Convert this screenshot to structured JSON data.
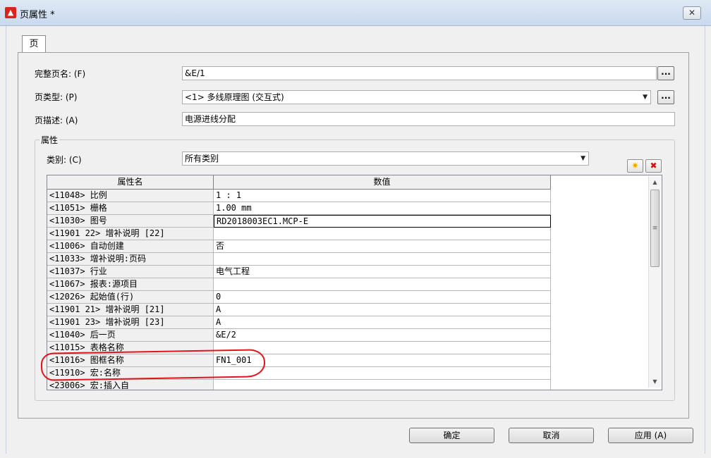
{
  "window": {
    "title": "页属性 *",
    "app_icon": "eplan-app-icon",
    "close_label": "✕"
  },
  "tab": {
    "label": "页"
  },
  "form": {
    "full_name_label": "完整页名: (F)",
    "full_name_value": "&E/1",
    "page_type_label": "页类型: (P)",
    "page_type_value": "<1> 多线原理图 (交互式)",
    "page_desc_label": "页描述: (A)",
    "page_desc_value": "电源进线分配",
    "dots_label": "..."
  },
  "properties": {
    "group_title": "属性",
    "category_label": "类别: (C)",
    "category_value": "所有类别",
    "new_icon": "new-star-icon",
    "delete_icon": "delete-x-icon",
    "columns": [
      "属性名",
      "数值"
    ],
    "rows": [
      {
        "name": "<11048> 比例",
        "value": "1 : 1"
      },
      {
        "name": "<11051> 栅格",
        "value": "1.00 mm"
      },
      {
        "name": "<11030> 图号",
        "value": "RD2018003EC1.MCP-E"
      },
      {
        "name": "<11901 22> 增补说明 [22]",
        "value": ""
      },
      {
        "name": "<11006> 自动创建",
        "value": "否"
      },
      {
        "name": "<11033> 增补说明:页码",
        "value": ""
      },
      {
        "name": "<11037> 行业",
        "value": "电气工程"
      },
      {
        "name": "<11067> 报表:源项目",
        "value": ""
      },
      {
        "name": "<12026> 起始值(行)",
        "value": "0"
      },
      {
        "name": "<11901 21> 增补说明 [21]",
        "value": "A"
      },
      {
        "name": "<11901 23> 增补说明 [23]",
        "value": "A"
      },
      {
        "name": "<11040> 后一页",
        "value": "&E/2"
      },
      {
        "name": "<11015> 表格名称",
        "value": ""
      },
      {
        "name": "<11016> 图框名称",
        "value": "FN1_001"
      },
      {
        "name": "<11910> 宏:名称",
        "value": ""
      },
      {
        "name": "<23006> 宏:插入自",
        "value": ""
      }
    ]
  },
  "buttons": {
    "ok": "确定",
    "cancel": "取消",
    "apply": "应用 (A)"
  },
  "colors": {
    "annotation": "#e3131e",
    "titlebar": "#c9d9ee",
    "dialog_bg": "#f0f0f0"
  }
}
